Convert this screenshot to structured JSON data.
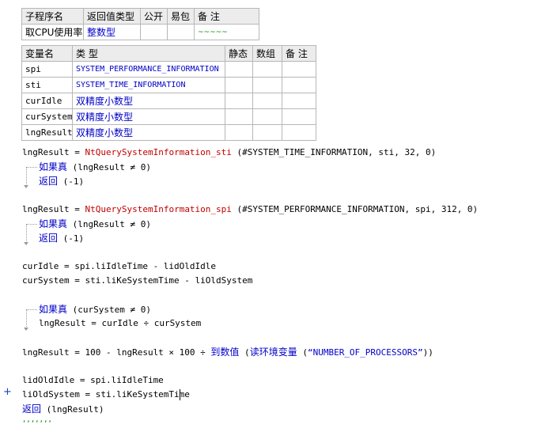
{
  "sub_table": {
    "headers": [
      "子程序名",
      "返回值类型",
      "公开",
      "易包",
      "备 注"
    ],
    "row": {
      "name": "取CPU使用率",
      "return_type": "整数型",
      "public": "",
      "easy_pack": "",
      "note": "~~~~~"
    }
  },
  "var_table": {
    "headers": [
      "变量名",
      "类 型",
      "静态",
      "数组",
      "备 注"
    ],
    "rows": [
      {
        "name": "spi",
        "type": "SYSTEM_PERFORMANCE_INFORMATION"
      },
      {
        "name": "sti",
        "type": "SYSTEM_TIME_INFORMATION"
      },
      {
        "name": "curIdle",
        "type": "双精度小数型"
      },
      {
        "name": "curSystem",
        "type": "双精度小数型"
      },
      {
        "name": "lngResult",
        "type": "双精度小数型"
      }
    ]
  },
  "code": {
    "l1_lhs": "lngResult = ",
    "l1_fn": "NtQuerySystemInformation_sti",
    "l1_args": " (#SYSTEM_TIME_INFORMATION, sti, 32, 0)",
    "if1_kw": "如果真",
    "if1_cond": " (lngResult ≠ 0)",
    "ret1_kw": "返回",
    "ret1_args": " (-1)",
    "l2_lhs": "lngResult = ",
    "l2_fn": "NtQuerySystemInformation_spi",
    "l2_args": " (#SYSTEM_PERFORMANCE_INFORMATION, spi, 312, 0)",
    "if2_kw": "如果真",
    "if2_cond": " (lngResult ≠ 0)",
    "ret2_kw": "返回",
    "ret2_args": " (-1)",
    "l3": "curIdle = spi.liIdleTime - lidOldIdle",
    "l4": "curSystem = sti.liKeSystemTime - liOldSystem",
    "if3_kw": "如果真",
    "if3_cond": " (curSystem ≠ 0)",
    "l5": "lngResult = curIdle ÷ curSystem",
    "l6_a": "lngResult = 100 - lngResult × 100 ÷ ",
    "l6_fn": "到数值",
    "l6_b": " (",
    "l6_fn2": "读环境变量",
    "l6_c": " (",
    "l6_str": "“NUMBER_OF_PROCESSORS”",
    "l6_d": "))",
    "l7": "lidOldIdle = spi.liIdleTime",
    "l8": "liOldSystem = sti.liKeSystemTime",
    "ret3_kw": "返回",
    "ret3_args": " (lngResult)",
    "trailing": ",,,,,,,"
  },
  "gutter": {
    "plus": "+"
  }
}
